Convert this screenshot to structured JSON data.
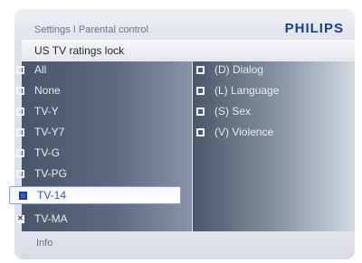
{
  "header": {
    "breadcrumb": "Settings I Parental control",
    "brand": "PHILIPS"
  },
  "section": {
    "title": "US TV ratings lock"
  },
  "left_list": {
    "items": [
      {
        "label": "All",
        "state": "unchecked"
      },
      {
        "label": "None",
        "state": "unchecked"
      },
      {
        "label": "TV-Y",
        "state": "unchecked"
      },
      {
        "label": "TV-Y7",
        "state": "unchecked"
      },
      {
        "label": "TV-G",
        "state": "unchecked"
      },
      {
        "label": "TV-PG",
        "state": "unchecked"
      },
      {
        "label": "TV-14",
        "state": "selected"
      },
      {
        "label": "TV-MA",
        "state": "checked"
      }
    ]
  },
  "right_list": {
    "items": [
      {
        "label": "(D) Dialog",
        "state": "unchecked"
      },
      {
        "label": "(L) Language",
        "state": "unchecked"
      },
      {
        "label": "(S) Sex",
        "state": "unchecked"
      },
      {
        "label": "(V) Violence",
        "state": "unchecked"
      }
    ]
  },
  "footer": {
    "info_label": "Info"
  },
  "colors": {
    "brand": "#1a3f8f",
    "selected_text": "#2b55c6",
    "selected_border": "#7aa3e6"
  }
}
